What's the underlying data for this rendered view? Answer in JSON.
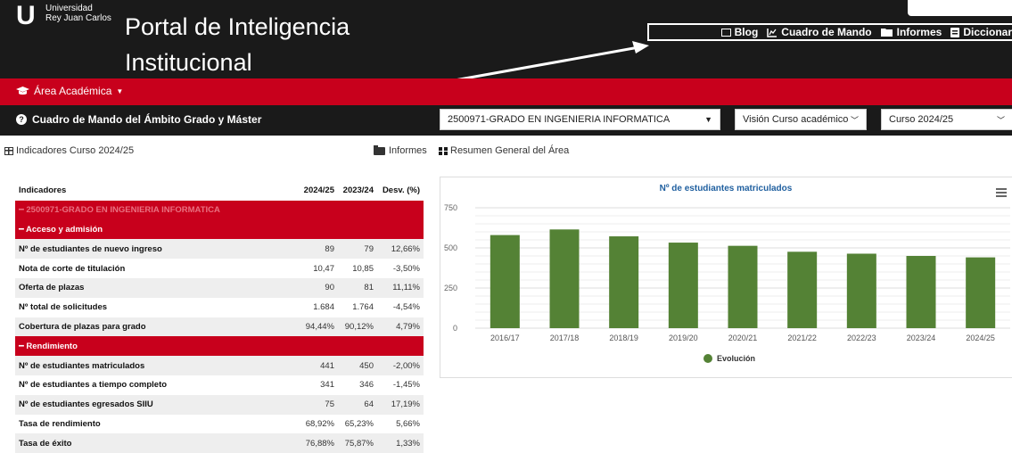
{
  "header": {
    "logo_letter": "U",
    "university_line1": "Universidad",
    "university_line2": "Rey Juan Carlos",
    "title": "Portal de Inteligencia Institucional",
    "nav": [
      {
        "label": "Blog",
        "icon": "newspaper-icon"
      },
      {
        "label": "Cuadro de Mando",
        "icon": "chart-line-icon"
      },
      {
        "label": "Informes",
        "icon": "folder-icon"
      },
      {
        "label": "Diccionar",
        "icon": "book-icon"
      }
    ]
  },
  "area_menu": {
    "label": "Área Académica",
    "icon": "graduation-cap-icon"
  },
  "dashboard": {
    "title": "Cuadro de Mando del Ámbito Grado y Máster",
    "degree_select": "2500971-GRADO EN INGENIERIA INFORMATICA",
    "vision_select": "Visión Curso académico",
    "course_select": "Curso 2024/25"
  },
  "toolbar": {
    "indicators_label": "Indicadores Curso 2024/25",
    "reports_label": "Informes",
    "summary_label": "Resumen General del Área"
  },
  "table": {
    "headers": [
      "Indicadores",
      "2024/25",
      "2023/24",
      "Desv. (%)"
    ],
    "degree_row": "2500971-GRADO EN INGENIERIA INFORMATICA",
    "sections": [
      {
        "label": "Acceso y admisión",
        "rows": [
          [
            "Nº de estudiantes de nuevo ingreso",
            "89",
            "79",
            "12,66%"
          ],
          [
            "Nota de corte de titulación",
            "10,47",
            "10,85",
            "-3,50%"
          ],
          [
            "Oferta de plazas",
            "90",
            "81",
            "11,11%"
          ],
          [
            "Nº total de solicitudes",
            "1.684",
            "1.764",
            "-4,54%"
          ],
          [
            "Cobertura de plazas para grado",
            "94,44%",
            "90,12%",
            "4,79%"
          ]
        ]
      },
      {
        "label": "Rendimiento",
        "rows": [
          [
            "Nº de estudiantes matriculados",
            "441",
            "450",
            "-2,00%"
          ],
          [
            "Nº de estudiantes a tiempo completo",
            "341",
            "346",
            "-1,45%"
          ],
          [
            "Nº de estudiantes egresados SIIU",
            "75",
            "64",
            "17,19%"
          ],
          [
            "Tasa de rendimiento",
            "68,92%",
            "65,23%",
            "5,66%"
          ],
          [
            "Tasa de éxito",
            "76,88%",
            "75,87%",
            "1,33%"
          ]
        ]
      }
    ]
  },
  "chart_data": {
    "type": "bar",
    "title": "Nº de estudiantes matriculados",
    "categories": [
      "2016/17",
      "2017/18",
      "2018/19",
      "2019/20",
      "2020/21",
      "2021/22",
      "2022/23",
      "2023/24",
      "2024/25"
    ],
    "series": [
      {
        "name": "Evolución",
        "values": [
          580,
          615,
          572,
          533,
          513,
          476,
          464,
          450,
          441
        ],
        "color": "#548235"
      }
    ],
    "yticks": [
      0,
      250,
      500,
      750
    ],
    "ylim": [
      0,
      750
    ],
    "legend": "bottom",
    "grid": true
  },
  "colors": {
    "accent_red": "#c8001c",
    "header_dark": "#1a1a1a",
    "bar_green": "#548235",
    "chart_title_blue": "#1f5f9f"
  }
}
